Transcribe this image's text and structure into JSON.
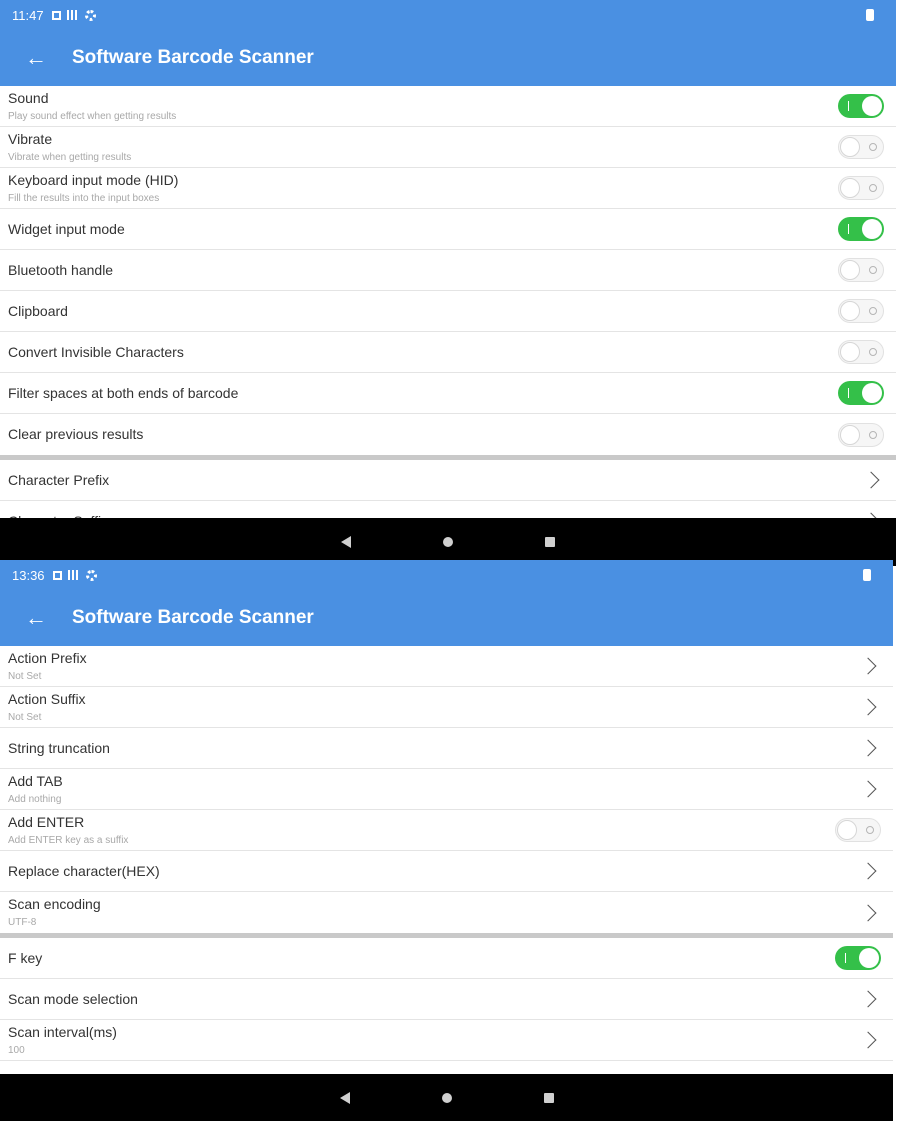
{
  "screen1": {
    "status_time": "11:47",
    "title": "Software Barcode Scanner",
    "rows": [
      {
        "label": "Sound",
        "sub": "Play sound effect when getting results",
        "toggle": "on"
      },
      {
        "label": "Vibrate",
        "sub": "Vibrate when getting results",
        "toggle": "off"
      },
      {
        "label": "Keyboard input mode (HID)",
        "sub": "Fill the results into the input boxes",
        "toggle": "off"
      },
      {
        "label": "Widget input mode",
        "toggle": "on"
      },
      {
        "label": "Bluetooth handle",
        "toggle": "off"
      },
      {
        "label": "Clipboard",
        "toggle": "off"
      },
      {
        "label": "Convert Invisible Characters",
        "toggle": "off"
      },
      {
        "label": "Filter spaces at both ends of barcode",
        "toggle": "on"
      },
      {
        "label": "Clear previous results",
        "toggle": "off"
      },
      {
        "label": "Character Prefix"
      },
      {
        "label": "Character Suffix"
      }
    ]
  },
  "screen2": {
    "status_time": "13:36",
    "title": "Software Barcode Scanner",
    "rows": [
      {
        "label": "Action Prefix",
        "sub": "Not Set"
      },
      {
        "label": "Action Suffix",
        "sub": "Not Set"
      },
      {
        "label": "String truncation"
      },
      {
        "label": "Add TAB",
        "sub": "Add nothing"
      },
      {
        "label": "Add ENTER",
        "sub": "Add ENTER key as a suffix",
        "toggle": "off"
      },
      {
        "label": "Replace character(HEX)"
      },
      {
        "label": "Scan encoding",
        "sub": "UTF-8"
      },
      {
        "label": "F key",
        "toggle": "on"
      },
      {
        "label": "Scan mode selection"
      },
      {
        "label": "Scan interval(ms)",
        "sub": "100"
      }
    ]
  },
  "icons": {
    "back": "arrow-back-icon",
    "chevron": "chevron-right-icon",
    "nav": [
      "nav-back-icon",
      "nav-home-icon",
      "nav-recent-icon"
    ]
  },
  "colors": {
    "accent": "#4a90e2",
    "toggle_on": "#34c049",
    "nav_bar": "#000000"
  }
}
